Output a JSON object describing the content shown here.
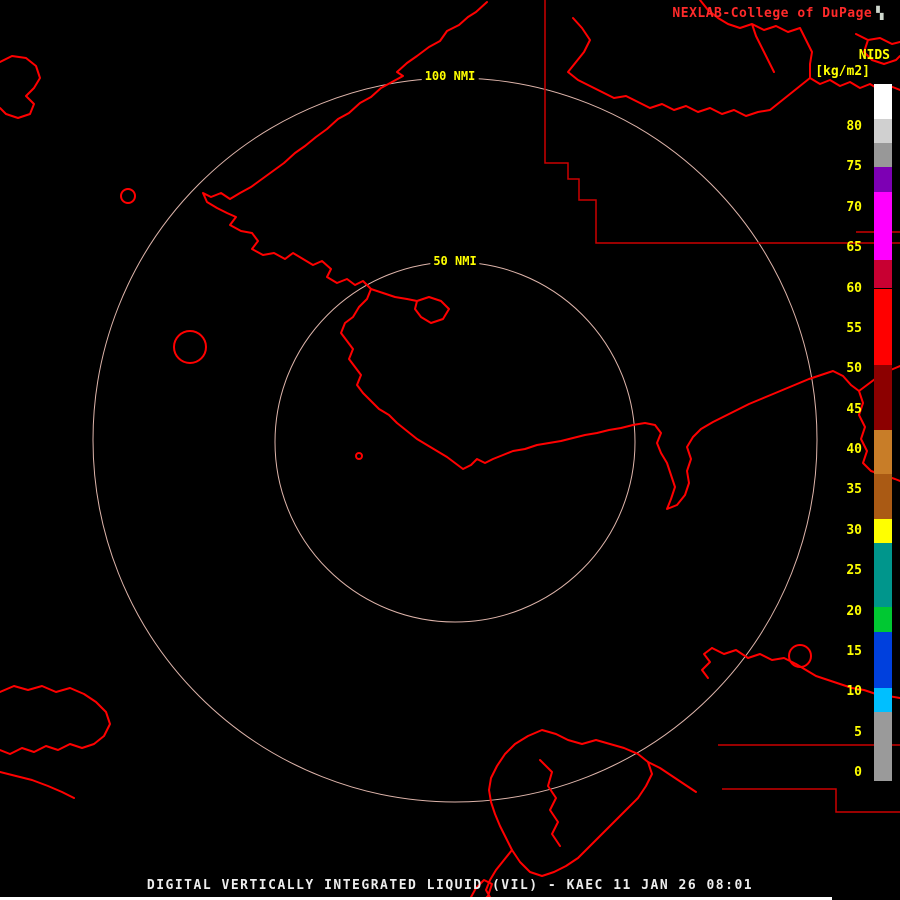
{
  "header": {
    "credit": "NEXLAB-College of DuPage",
    "logo_glyph": "▚"
  },
  "colorbar": {
    "title": "NIDS",
    "units": "[kg/m2]",
    "ticks": [
      "80",
      "75",
      "70",
      "65",
      "60",
      "55",
      "50",
      "45",
      "40",
      "35",
      "30",
      "25",
      "20",
      "15",
      "10",
      "5",
      "0"
    ],
    "value_range": [
      0,
      85
    ],
    "segments": [
      {
        "min": 81,
        "max": 85.3,
        "color": "#ffffff"
      },
      {
        "min": 78,
        "max": 81,
        "color": "#d0d0d0"
      },
      {
        "min": 75,
        "max": 78,
        "color": "#989898"
      },
      {
        "min": 72,
        "max": 75,
        "color": "#7d00b4"
      },
      {
        "min": 63.5,
        "max": 72,
        "color": "#ff00ff"
      },
      {
        "min": 60,
        "max": 63.5,
        "color": "#c80032"
      },
      {
        "min": 50.5,
        "max": 60,
        "color": "#ff0000"
      },
      {
        "min": 42.5,
        "max": 50.5,
        "color": "#8c0000"
      },
      {
        "min": 37,
        "max": 42.5,
        "color": "#c87d28"
      },
      {
        "min": 31.5,
        "max": 37,
        "color": "#aa5a14"
      },
      {
        "min": 28.5,
        "max": 31.5,
        "color": "#ffff00"
      },
      {
        "min": 20.5,
        "max": 28.5,
        "color": "#00968c"
      },
      {
        "min": 17.5,
        "max": 20.5,
        "color": "#00c832"
      },
      {
        "min": 10.5,
        "max": 17.5,
        "color": "#0040dd"
      },
      {
        "min": 7.5,
        "max": 10.5,
        "color": "#00bfff"
      },
      {
        "min": -1,
        "max": 7.5,
        "color": "#9a9a9a"
      }
    ]
  },
  "rings": {
    "outer_label": "100 NMI",
    "inner_label": "50 NMI"
  },
  "footer": {
    "product_line": "DIGITAL VERTICALLY INTEGRATED LIQUID (VIL) - KAEC 11 JAN 26 08:01"
  },
  "colors": {
    "background": "#000000",
    "coastline": "#ff0000",
    "boundary": "#cc0000",
    "ring": "#dfb5ab",
    "label_yellow": "#ffff00",
    "credit_red": "#ff2a2a",
    "footer_text": "#ededed"
  }
}
